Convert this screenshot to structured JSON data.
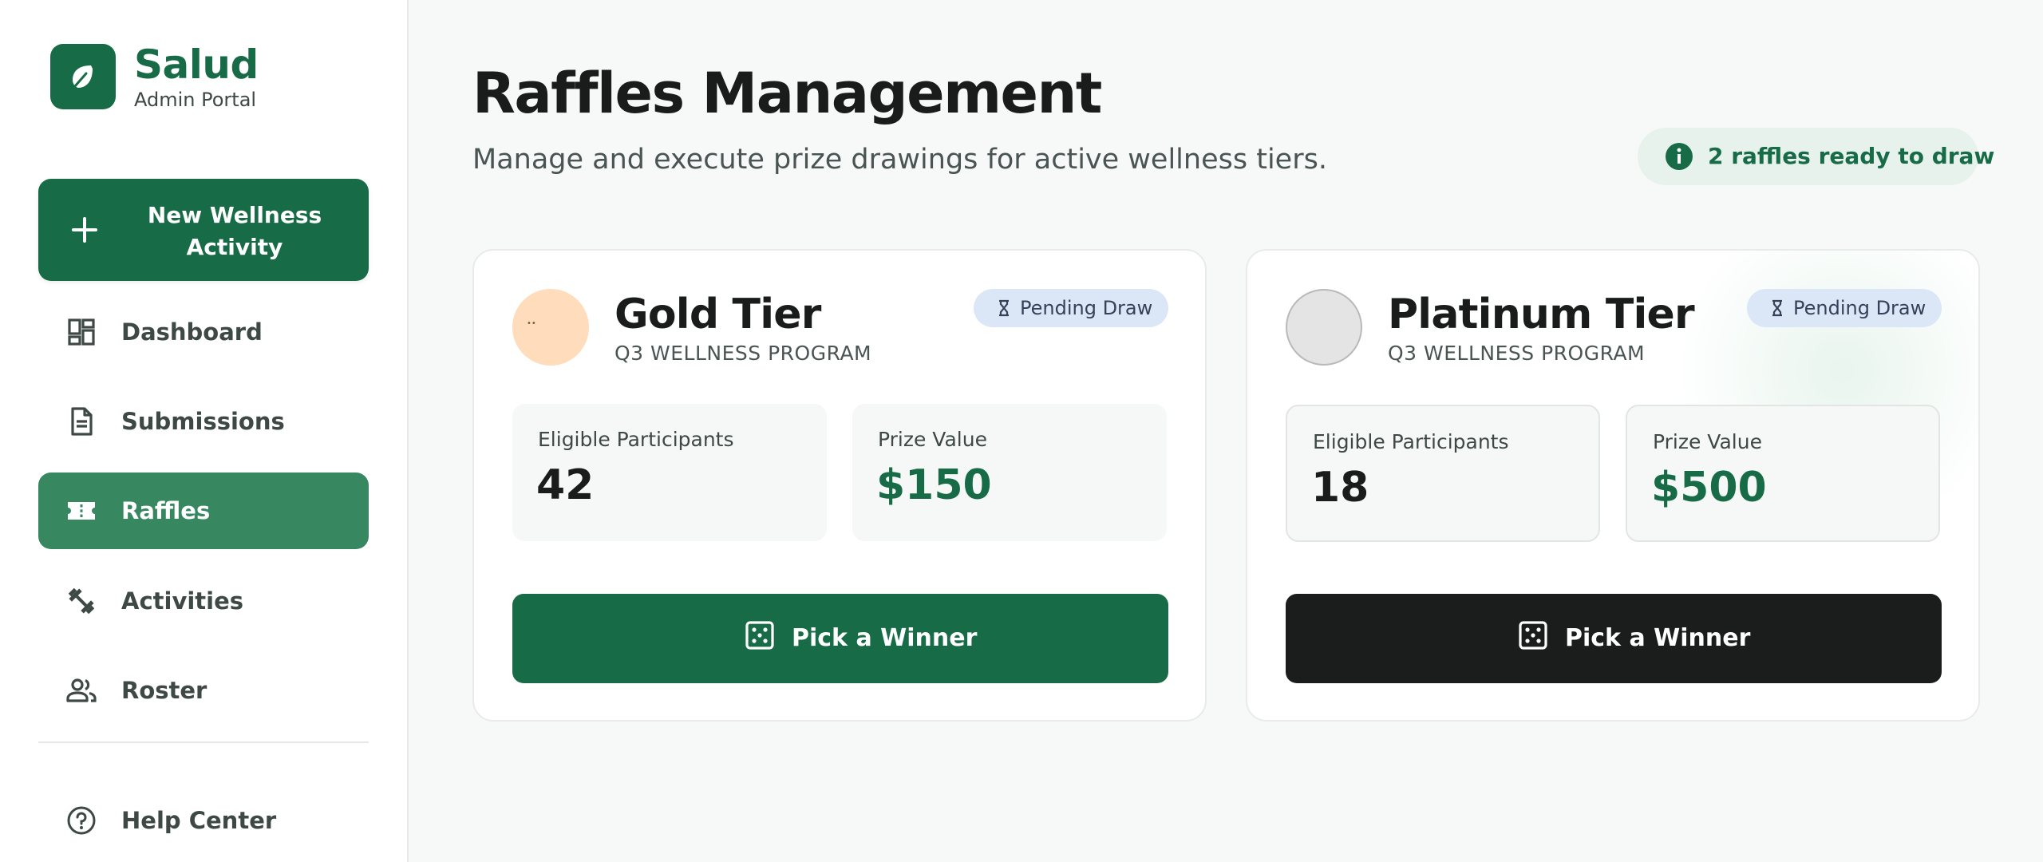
{
  "brand": {
    "name": "Salud",
    "subtitle": "Admin Portal",
    "logo_icon": "leaf-icon"
  },
  "sidebar": {
    "new_activity": {
      "label": "New Wellness Activity",
      "icon": "plus-icon"
    },
    "items": [
      {
        "label": "Dashboard",
        "icon": "dashboard-icon",
        "active": false
      },
      {
        "label": "Submissions",
        "icon": "document-icon",
        "active": false
      },
      {
        "label": "Raffles",
        "icon": "ticket-icon",
        "active": true
      },
      {
        "label": "Activities",
        "icon": "dumbbell-icon",
        "active": false
      },
      {
        "label": "Roster",
        "icon": "people-icon",
        "active": false
      }
    ],
    "help": {
      "label": "Help Center",
      "icon": "help-icon"
    }
  },
  "page": {
    "title": "Raffles Management",
    "subtitle": "Manage and execute prize drawings for active wellness tiers.",
    "ready_banner": "2 raffles ready to draw"
  },
  "cards": [
    {
      "tier": "Gold Tier",
      "program": "Q3 WELLNESS PROGRAM",
      "status": "Pending Draw",
      "participants_label": "Eligible Participants",
      "participants": "42",
      "prize_label": "Prize Value",
      "prize": "$150",
      "button_label": "Pick a Winner"
    },
    {
      "tier": "Platinum Tier",
      "program": "Q3 WELLNESS PROGRAM",
      "status": "Pending Draw",
      "participants_label": "Eligible Participants",
      "participants": "18",
      "prize_label": "Prize Value",
      "prize": "$500",
      "button_label": "Pick a Winner"
    }
  ],
  "colors": {
    "brand_green": "#186b47",
    "active_nav": "#378760",
    "pill_blue": "#dbe6f7",
    "dark_button": "#1b1c1c",
    "gold_badge": "#ffdcbb"
  }
}
